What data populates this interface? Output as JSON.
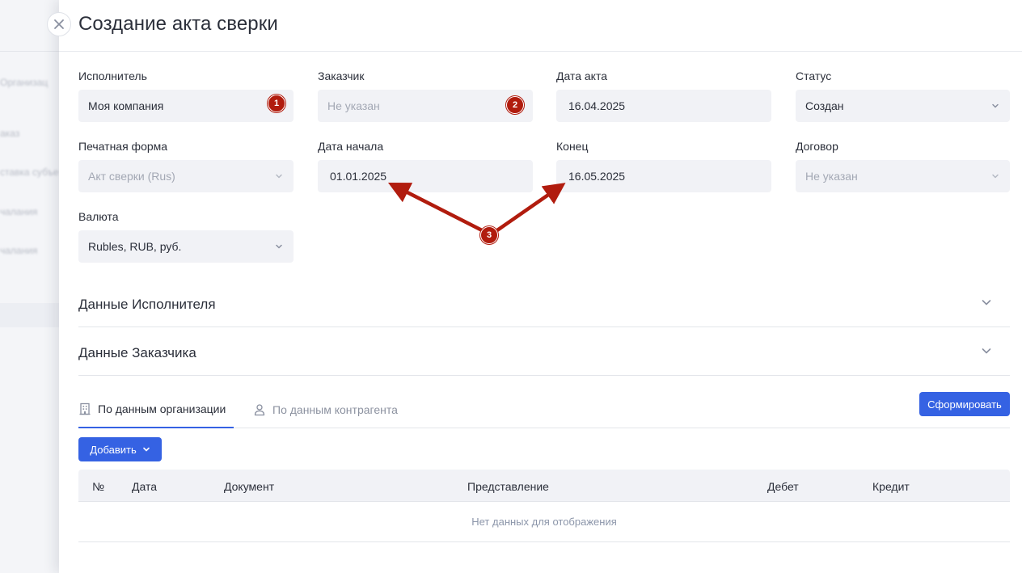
{
  "background": {
    "items": [
      "Организац",
      "аказ",
      "ставка субъе",
      "чалания",
      "чалания"
    ]
  },
  "dialog": {
    "title": "Создание акта сверки"
  },
  "fields": {
    "executor": {
      "label": "Исполнитель",
      "value": "Моя компания"
    },
    "customer": {
      "label": "Заказчик",
      "value": "Не указан"
    },
    "act_date": {
      "label": "Дата акта",
      "value": "16.04.2025"
    },
    "status": {
      "label": "Статус",
      "value": "Создан"
    },
    "print_form": {
      "label": "Печатная форма",
      "value": "Акт сверки (Rus)"
    },
    "start_date": {
      "label": "Дата начала",
      "value": "01.01.2025"
    },
    "end_date": {
      "label": "Конец",
      "value": "16.05.2025"
    },
    "contract": {
      "label": "Договор",
      "value": "Не указан"
    },
    "currency": {
      "label": "Валюта",
      "value": "Rubles, RUB, руб."
    }
  },
  "sections": {
    "executor_data": "Данные Исполнителя",
    "customer_data": "Данные Заказчика"
  },
  "tabs": {
    "organization": "По данным организации",
    "counterparty": "По данным контрагента"
  },
  "buttons": {
    "generate": "Сформировать",
    "add": "Добавить"
  },
  "table": {
    "columns": [
      "№",
      "Дата",
      "Документ",
      "Представление",
      "Дебет",
      "Кредит"
    ],
    "empty": "Нет данных для отображения"
  },
  "annotations": {
    "badge_1": "1",
    "badge_2": "2",
    "badge_3": "3",
    "color": "#b11c0e"
  },
  "colors": {
    "accent": "#3562e3",
    "field_bg": "#f1f2f6"
  }
}
